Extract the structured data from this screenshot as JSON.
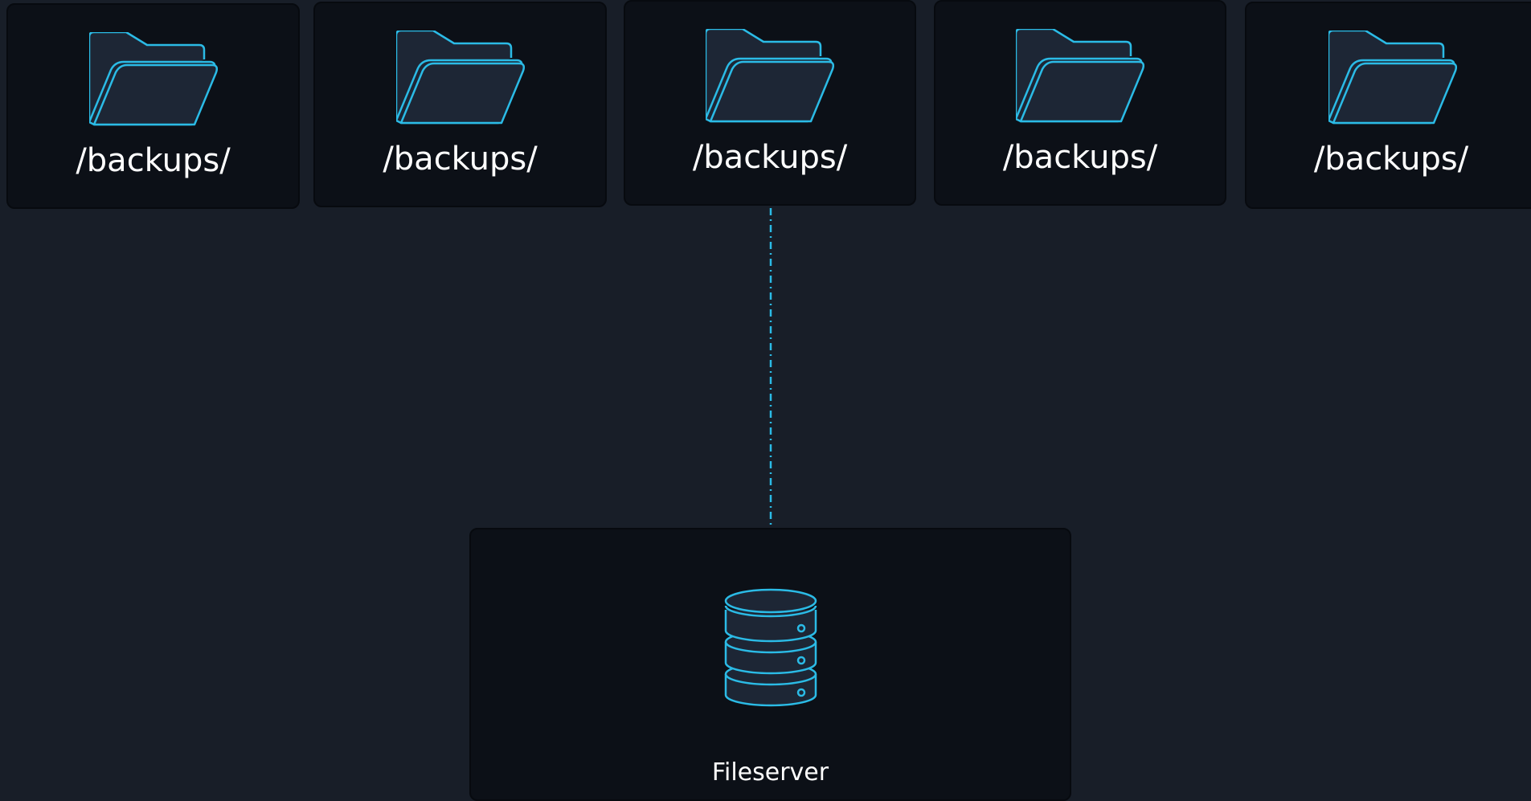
{
  "colors": {
    "background": "#181e28",
    "card": "#0c1017",
    "accent": "#2bbbe6",
    "text": "#ffffff"
  },
  "folders": [
    {
      "label": "/backups/",
      "icon": "folder-open-icon"
    },
    {
      "label": "/backups/",
      "icon": "folder-open-icon"
    },
    {
      "label": "/backups/",
      "icon": "folder-open-icon"
    },
    {
      "label": "/backups/",
      "icon": "folder-open-icon"
    },
    {
      "label": "/backups/",
      "icon": "folder-open-icon"
    }
  ],
  "server": {
    "label": "Fileserver",
    "icon": "database-icon"
  },
  "connection": {
    "from": "server",
    "to": "folder-3",
    "style": "dash-dot"
  }
}
